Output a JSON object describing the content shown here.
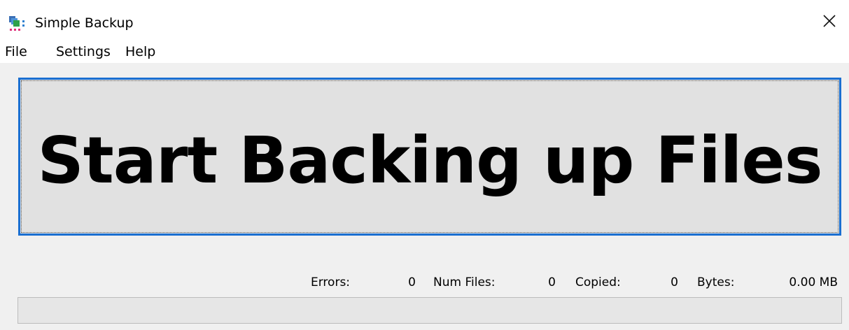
{
  "window": {
    "title": "Simple Backup",
    "close_glyph": "✕"
  },
  "menu": {
    "items": [
      {
        "label": "File"
      },
      {
        "label": "Settings"
      },
      {
        "label": "Help"
      }
    ]
  },
  "main_button": {
    "label": "Start Backing up Files"
  },
  "stats": {
    "errors_label": "Errors:",
    "errors_value": "0",
    "num_files_label": "Num Files:",
    "num_files_value": "0",
    "copied_label": "Copied:",
    "copied_value": "0",
    "bytes_label": "Bytes:",
    "bytes_value": "0.00 MB"
  },
  "progress": {
    "fraction": 0
  },
  "colors": {
    "button_border": "#1a6fd1",
    "button_face": "#e1e1e1",
    "window_bg": "#f0f0f0",
    "progress_fill": "#06b025"
  },
  "icons": {
    "app_icon": "backup-app-icon",
    "close_icon": "close-icon"
  }
}
